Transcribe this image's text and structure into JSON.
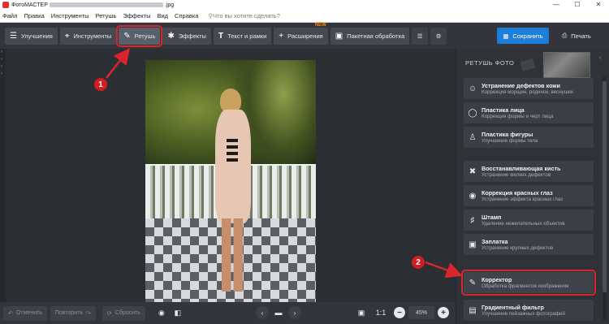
{
  "window": {
    "app_name": "ФотоМАСТЕР",
    "file_ext": ".jpg",
    "controls": [
      "—",
      "☐",
      "✕"
    ]
  },
  "menu": {
    "items": [
      "Файл",
      "Правка",
      "Инструменты",
      "Ретушь",
      "Эффекты",
      "Вид",
      "Справка"
    ],
    "search_placeholder": "Что вы хотите сделать?"
  },
  "toolbar": {
    "tabs": [
      {
        "label": "Улучшения",
        "icon": "sliders-icon"
      },
      {
        "label": "Инструменты",
        "icon": "crop-icon"
      },
      {
        "label": "Ретушь",
        "icon": "brush-icon",
        "active": true
      },
      {
        "label": "Эффекты",
        "icon": "magic-wand-icon"
      },
      {
        "label": "Текст и рамки",
        "icon": "text-icon"
      },
      {
        "label": "Расширения",
        "icon": "plus-icon",
        "badge": "NEW"
      },
      {
        "label": "Пакетная обработка",
        "icon": "batch-icon"
      }
    ],
    "save_label": "Сохранить",
    "print_label": "Печать"
  },
  "panel": {
    "title": "РЕТУШЬ ФОТО",
    "tools": [
      {
        "name": "Устранение дефектов кожи",
        "desc": "Коррекция морщин, родинок, веснушек",
        "icon": "face-icon"
      },
      {
        "name": "Пластика лица",
        "desc": "Коррекция формы и черт лица",
        "icon": "face-outline-icon"
      },
      {
        "name": "Пластика фигуры",
        "desc": "Улучшение формы тела",
        "icon": "figure-icon"
      },
      {
        "name": "Восстанавливающая кисть",
        "desc": "Устранение мелких дефектов",
        "icon": "bandage-icon"
      },
      {
        "name": "Коррекция красных глаз",
        "desc": "Устранение эффекта красных глаз",
        "icon": "eye-icon"
      },
      {
        "name": "Штамп",
        "desc": "Удаление нежелательных объектов",
        "icon": "stamp-icon"
      },
      {
        "name": "Заплатка",
        "desc": "Устранение крупных дефектов",
        "icon": "patch-icon"
      },
      {
        "name": "Корректор",
        "desc": "Обработка фрагментов изображения",
        "icon": "brush-icon",
        "highlight": true
      },
      {
        "name": "Градиентный фильтр",
        "desc": "Улучшение пейзажных фотографий",
        "icon": "gradient-icon"
      }
    ]
  },
  "bottom": {
    "undo_label": "Отменить",
    "redo_label": "Повторить",
    "reset_label": "Сбросить",
    "ratio_label": "1:1",
    "zoom_value": "45%"
  },
  "markers": {
    "one": "1",
    "two": "2"
  },
  "colors": {
    "accent": "#1e7fd8",
    "annotation_red": "#d8262c"
  }
}
